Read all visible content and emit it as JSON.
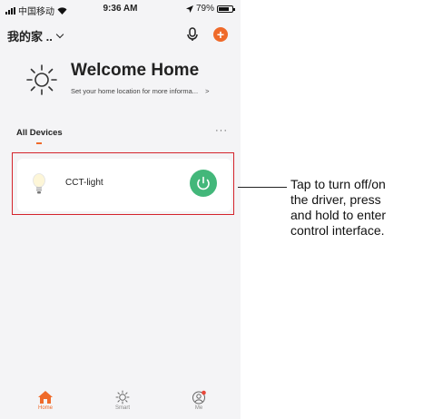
{
  "status_bar": {
    "carrier": "中国移动",
    "time": "9:36 AM",
    "battery": "79%",
    "battery_level": 0.79
  },
  "header": {
    "home_name": "我的家 ..",
    "add_label": "+"
  },
  "welcome": {
    "title": "Welcome Home",
    "hint": "Set your home location for more informa...",
    "hint_arrow": ">"
  },
  "devices_section": {
    "label": "All Devices",
    "more_label": "···"
  },
  "device": {
    "name": "CCT-light"
  },
  "tabbar": {
    "tabs": [
      {
        "label": "Home"
      },
      {
        "label": "Smart"
      },
      {
        "label": "Me"
      }
    ]
  },
  "callout": {
    "lines": [
      "Tap to turn off/on",
      "the driver, press",
      "and hold to enter",
      "control interface."
    ]
  },
  "colors": {
    "accent": "#ef6a2a",
    "power": "#43b77a",
    "highlight": "#d4242c"
  }
}
